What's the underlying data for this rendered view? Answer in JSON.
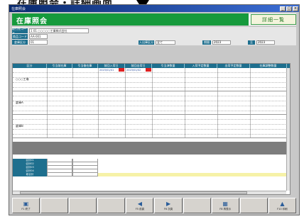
{
  "caption": "在庫照会・詳細画面",
  "window": {
    "title": "在庫照会",
    "controls": [
      "_",
      "□",
      "×"
    ]
  },
  "header": {
    "title": "在庫照会",
    "detail_button": "詳細一覧"
  },
  "filters": {
    "row1": {
      "label": "取引先コード",
      "value": "1 01  ○○○○○工業株式会社"
    },
    "row2": {
      "label": "商品コード",
      "value": "AA-001"
    },
    "row3": {
      "label": "倉庫区分",
      "value": "01"
    },
    "extra": [
      {
        "label": "入出庫区分",
        "value": "全て"
      },
      {
        "label": "期間",
        "value": "2023"
      },
      {
        "label": "至",
        "value": "2023"
      }
    ]
  },
  "grid": {
    "columns": [
      "区分",
      "引当前在庫",
      "引当後在庫",
      "前回入荷日",
      "前回出荷日",
      "引当済数量",
      "入荷予定数量",
      "出荷予定数量",
      "在庫調整数量"
    ],
    "groups": [
      {
        "label": "○○○工場",
        "dates": [
          "2023/01/01",
          "2023/01/02"
        ]
      },
      {
        "label": "倉庫A",
        "dates": []
      },
      {
        "label": "倉庫B",
        "dates": []
      }
    ],
    "totals": [
      {
        "label": "合計01"
      },
      {
        "label": "合計02"
      },
      {
        "label": "合計03"
      },
      {
        "label": "合計04"
      },
      {
        "label": "総合計"
      }
    ]
  },
  "fkeys": [
    {
      "label": "F1 終了",
      "icon": "exit-icon"
    },
    {
      "label": "",
      "icon": ""
    },
    {
      "label": "",
      "icon": ""
    },
    {
      "label": "",
      "icon": ""
    },
    {
      "label": "F5 前頁",
      "icon": "left-arrow-icon"
    },
    {
      "label": "F6 次頁",
      "icon": "right-arrow-icon"
    },
    {
      "label": "",
      "icon": ""
    },
    {
      "label": "F8 再表示",
      "icon": "refresh-icon"
    },
    {
      "label": "",
      "icon": ""
    },
    {
      "label": "F10 印刷",
      "icon": "print-icon"
    }
  ]
}
